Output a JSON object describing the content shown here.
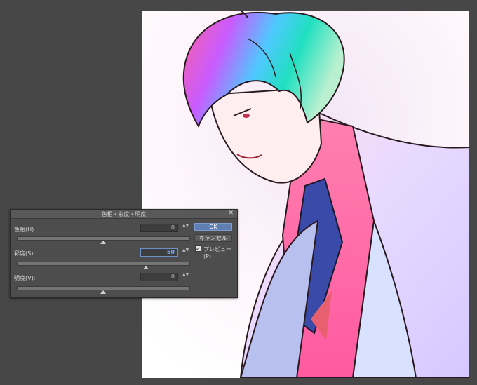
{
  "dialog": {
    "title": "色相・彩度・明度",
    "close_glyph": "✕",
    "rows": [
      {
        "label": "色相(H):",
        "value": "0",
        "slider_fraction": 0.5
      },
      {
        "label": "彩度(S):",
        "value": "50",
        "slider_fraction": 0.75
      },
      {
        "label": "明度(V):",
        "value": "0",
        "slider_fraction": 0.5
      }
    ],
    "ok_label": "OK",
    "cancel_label": "キャンセル",
    "preview_label": "プレビュー(P)",
    "preview_checked": true,
    "check_glyph": "✓",
    "spin_glyph": "▲▼"
  },
  "colors": {
    "workspace": "#474747",
    "dialog_bg": "#4d4d4d",
    "accent": "#5f7fb3"
  }
}
